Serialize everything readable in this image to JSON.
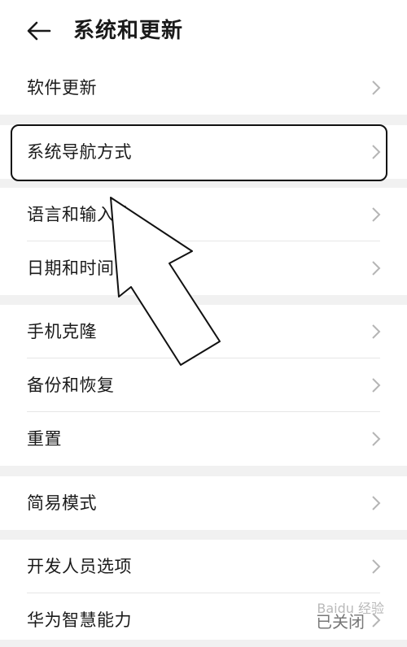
{
  "header": {
    "title": "系统和更新",
    "back_icon": "arrow-left-icon"
  },
  "groups": [
    {
      "items": [
        {
          "label": "软件更新"
        }
      ]
    },
    {
      "items": [
        {
          "label": "系统导航方式"
        }
      ]
    },
    {
      "items": [
        {
          "label": "语言和输入法"
        },
        {
          "label": "日期和时间"
        }
      ]
    },
    {
      "items": [
        {
          "label": "手机克隆"
        },
        {
          "label": "备份和恢复"
        },
        {
          "label": "重置"
        }
      ]
    },
    {
      "items": [
        {
          "label": "简易模式"
        }
      ]
    },
    {
      "items": [
        {
          "label": "开发人员选项"
        },
        {
          "label": "华为智慧能力",
          "value": "已关闭"
        }
      ]
    }
  ],
  "watermark": "Baidu 经验",
  "colors": {
    "background": "#f1f1f1",
    "card": "#ffffff",
    "text": "#1a1a1a",
    "chevron": "#b5b5b5"
  }
}
